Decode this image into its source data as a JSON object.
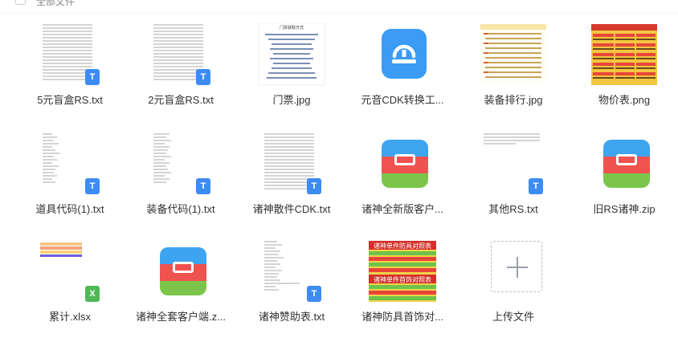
{
  "header": {
    "select_all_label": "全部文件"
  },
  "files": [
    {
      "name": "5元盲盒RS.txt",
      "type": "txt"
    },
    {
      "name": "2元盲盒RS.txt",
      "type": "txt"
    },
    {
      "name": "门票.jpg",
      "type": "jpg",
      "thumb_title": "门票获取方式"
    },
    {
      "name": "元音CDK转换工...",
      "type": "app"
    },
    {
      "name": "装备排行.jpg",
      "type": "jpg"
    },
    {
      "name": "物价表.png",
      "type": "png"
    },
    {
      "name": "道具代码(1).txt",
      "type": "txt"
    },
    {
      "name": "装备代码(1).txt",
      "type": "txt"
    },
    {
      "name": "诸神散件CDK.txt",
      "type": "txt"
    },
    {
      "name": "诸神全新版客户...",
      "type": "zip"
    },
    {
      "name": "其他RS.txt",
      "type": "txt"
    },
    {
      "name": "旧RS诸神.zip",
      "type": "zip"
    },
    {
      "name": "累计.xlsx",
      "type": "xlsx"
    },
    {
      "name": "诸神全套客户端.z...",
      "type": "zip"
    },
    {
      "name": "诸神赞助表.txt",
      "type": "txt"
    },
    {
      "name": "诸神防具首饰对...",
      "type": "jpg",
      "thumb_banner_1": "诸神单件防具对照表",
      "thumb_banner_2": "诸神单件首饰对照表"
    },
    {
      "name": "上传文件",
      "type": "upload"
    }
  ],
  "badges": {
    "txt": "T",
    "xlsx": "X"
  },
  "colors": {
    "txt_badge": "#3d8bf5",
    "xlsx_badge": "#4fb855",
    "app_icon": "#3b9bf5",
    "zip_top": "#3ea4f0",
    "zip_mid": "#ef5350",
    "zip_bottom": "#7bc64a"
  }
}
